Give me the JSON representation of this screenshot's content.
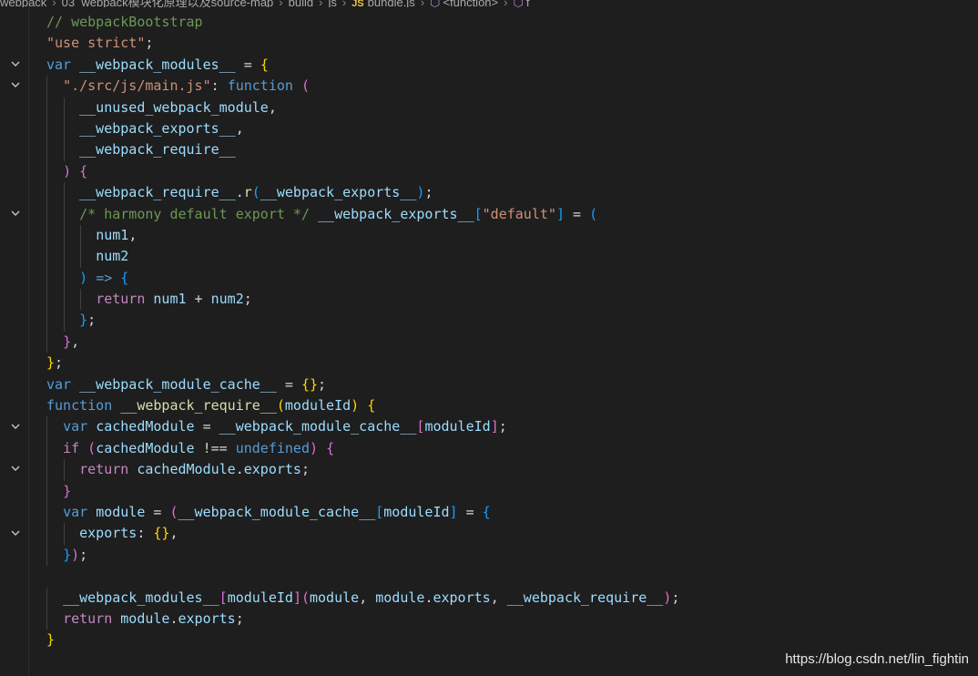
{
  "breadcrumb": {
    "items": [
      "webpack",
      "03_webpack模块化原理以及source-map",
      "build",
      "js",
      "bundle.js",
      "<function>"
    ],
    "js_icon": "JS",
    "file_icon": "js-file-icon",
    "symbol_icon": "symbol-method-icon",
    "trailing": "f"
  },
  "editor": {
    "fold_icon": "chevron-down-icon",
    "fold_lines": [
      2,
      3,
      9,
      19,
      21,
      24
    ],
    "lines": [
      {
        "indent": 0,
        "tokens": [
          [
            "comment",
            "// webpackBootstrap"
          ]
        ]
      },
      {
        "indent": 0,
        "tokens": [
          [
            "string",
            "\"use strict\""
          ],
          [
            "p",
            ";"
          ]
        ]
      },
      {
        "indent": 0,
        "tokens": [
          [
            "kw",
            "var"
          ],
          [
            "p",
            " "
          ],
          [
            "var",
            "__webpack_modules__"
          ],
          [
            "p",
            " = "
          ],
          [
            "b1",
            "{"
          ]
        ]
      },
      {
        "indent": 1,
        "tokens": [
          [
            "string",
            "\"./src/js/main.js\""
          ],
          [
            "p",
            ": "
          ],
          [
            "kw",
            "function"
          ],
          [
            "p",
            " "
          ],
          [
            "b2",
            "("
          ]
        ]
      },
      {
        "indent": 2,
        "tokens": [
          [
            "var",
            "__unused_webpack_module"
          ],
          [
            "p",
            ","
          ]
        ]
      },
      {
        "indent": 2,
        "tokens": [
          [
            "var",
            "__webpack_exports__"
          ],
          [
            "p",
            ","
          ]
        ]
      },
      {
        "indent": 2,
        "tokens": [
          [
            "var",
            "__webpack_require__"
          ]
        ]
      },
      {
        "indent": 1,
        "tokens": [
          [
            "b2",
            ")"
          ],
          [
            "p",
            " "
          ],
          [
            "b2",
            "{"
          ]
        ]
      },
      {
        "indent": 2,
        "tokens": [
          [
            "var",
            "__webpack_require__"
          ],
          [
            "p",
            "."
          ],
          [
            "fn",
            "r"
          ],
          [
            "b3",
            "("
          ],
          [
            "var",
            "__webpack_exports__"
          ],
          [
            "b3",
            ")"
          ],
          [
            "p",
            ";"
          ]
        ]
      },
      {
        "indent": 2,
        "tokens": [
          [
            "comment",
            "/* harmony default export */"
          ],
          [
            "p",
            " "
          ],
          [
            "var",
            "__webpack_exports__"
          ],
          [
            "b3",
            "["
          ],
          [
            "string",
            "\"default\""
          ],
          [
            "b3",
            "]"
          ],
          [
            "p",
            " = "
          ],
          [
            "b3",
            "("
          ]
        ]
      },
      {
        "indent": 3,
        "tokens": [
          [
            "var",
            "num1"
          ],
          [
            "p",
            ","
          ]
        ]
      },
      {
        "indent": 3,
        "tokens": [
          [
            "var",
            "num2"
          ]
        ]
      },
      {
        "indent": 2,
        "tokens": [
          [
            "b3",
            ")"
          ],
          [
            "p",
            " "
          ],
          [
            "kw",
            "=>"
          ],
          [
            "p",
            " "
          ],
          [
            "b3",
            "{"
          ]
        ]
      },
      {
        "indent": 3,
        "tokens": [
          [
            "ctrl",
            "return"
          ],
          [
            "p",
            " "
          ],
          [
            "var",
            "num1"
          ],
          [
            "p",
            " + "
          ],
          [
            "var",
            "num2"
          ],
          [
            "p",
            ";"
          ]
        ]
      },
      {
        "indent": 2,
        "tokens": [
          [
            "b3",
            "}"
          ],
          [
            "p",
            ";"
          ]
        ]
      },
      {
        "indent": 1,
        "tokens": [
          [
            "b2",
            "}"
          ],
          [
            "p",
            ","
          ]
        ]
      },
      {
        "indent": 0,
        "tokens": [
          [
            "b1",
            "}"
          ],
          [
            "p",
            ";"
          ]
        ]
      },
      {
        "indent": 0,
        "tokens": [
          [
            "kw",
            "var"
          ],
          [
            "p",
            " "
          ],
          [
            "var",
            "__webpack_module_cache__"
          ],
          [
            "p",
            " = "
          ],
          [
            "b1",
            "{}"
          ],
          [
            "p",
            ";"
          ]
        ]
      },
      {
        "indent": 0,
        "tokens": [
          [
            "kw",
            "function"
          ],
          [
            "p",
            " "
          ],
          [
            "fn",
            "__webpack_require__"
          ],
          [
            "b1",
            "("
          ],
          [
            "var",
            "moduleId"
          ],
          [
            "b1",
            ")"
          ],
          [
            "p",
            " "
          ],
          [
            "b1",
            "{"
          ]
        ]
      },
      {
        "indent": 1,
        "tokens": [
          [
            "kw",
            "var"
          ],
          [
            "p",
            " "
          ],
          [
            "var",
            "cachedModule"
          ],
          [
            "p",
            " = "
          ],
          [
            "var",
            "__webpack_module_cache__"
          ],
          [
            "b2",
            "["
          ],
          [
            "var",
            "moduleId"
          ],
          [
            "b2",
            "]"
          ],
          [
            "p",
            ";"
          ]
        ]
      },
      {
        "indent": 1,
        "tokens": [
          [
            "ctrl",
            "if"
          ],
          [
            "p",
            " "
          ],
          [
            "b2",
            "("
          ],
          [
            "var",
            "cachedModule"
          ],
          [
            "p",
            " !== "
          ],
          [
            "kw",
            "undefined"
          ],
          [
            "b2",
            ")"
          ],
          [
            "p",
            " "
          ],
          [
            "b2",
            "{"
          ]
        ]
      },
      {
        "indent": 2,
        "tokens": [
          [
            "ctrl",
            "return"
          ],
          [
            "p",
            " "
          ],
          [
            "var",
            "cachedModule"
          ],
          [
            "p",
            "."
          ],
          [
            "var",
            "exports"
          ],
          [
            "p",
            ";"
          ]
        ]
      },
      {
        "indent": 1,
        "tokens": [
          [
            "b2",
            "}"
          ]
        ]
      },
      {
        "indent": 1,
        "tokens": [
          [
            "kw",
            "var"
          ],
          [
            "p",
            " "
          ],
          [
            "var",
            "module"
          ],
          [
            "p",
            " = "
          ],
          [
            "b2",
            "("
          ],
          [
            "var",
            "__webpack_module_cache__"
          ],
          [
            "b3",
            "["
          ],
          [
            "var",
            "moduleId"
          ],
          [
            "b3",
            "]"
          ],
          [
            "p",
            " = "
          ],
          [
            "b3",
            "{"
          ]
        ]
      },
      {
        "indent": 2,
        "tokens": [
          [
            "var",
            "exports"
          ],
          [
            "p",
            ": "
          ],
          [
            "b1",
            "{}"
          ],
          [
            "p",
            ","
          ]
        ]
      },
      {
        "indent": 1,
        "tokens": [
          [
            "b3",
            "}"
          ],
          [
            "b2",
            ")"
          ],
          [
            "p",
            ";"
          ]
        ]
      },
      {
        "indent": 0,
        "tokens": []
      },
      {
        "indent": 1,
        "tokens": [
          [
            "var",
            "__webpack_modules__"
          ],
          [
            "b2",
            "["
          ],
          [
            "var",
            "moduleId"
          ],
          [
            "b2",
            "]"
          ],
          [
            "b2",
            "("
          ],
          [
            "var",
            "module"
          ],
          [
            "p",
            ", "
          ],
          [
            "var",
            "module"
          ],
          [
            "p",
            "."
          ],
          [
            "var",
            "exports"
          ],
          [
            "p",
            ", "
          ],
          [
            "var",
            "__webpack_require__"
          ],
          [
            "b2",
            ")"
          ],
          [
            "p",
            ";"
          ]
        ]
      },
      {
        "indent": 1,
        "tokens": [
          [
            "ctrl",
            "return"
          ],
          [
            "p",
            " "
          ],
          [
            "var",
            "module"
          ],
          [
            "p",
            "."
          ],
          [
            "var",
            "exports"
          ],
          [
            "p",
            ";"
          ]
        ]
      },
      {
        "indent": 0,
        "tokens": [
          [
            "b1",
            "}"
          ]
        ]
      }
    ]
  },
  "watermark": "https://blog.csdn.net/lin_fightin"
}
